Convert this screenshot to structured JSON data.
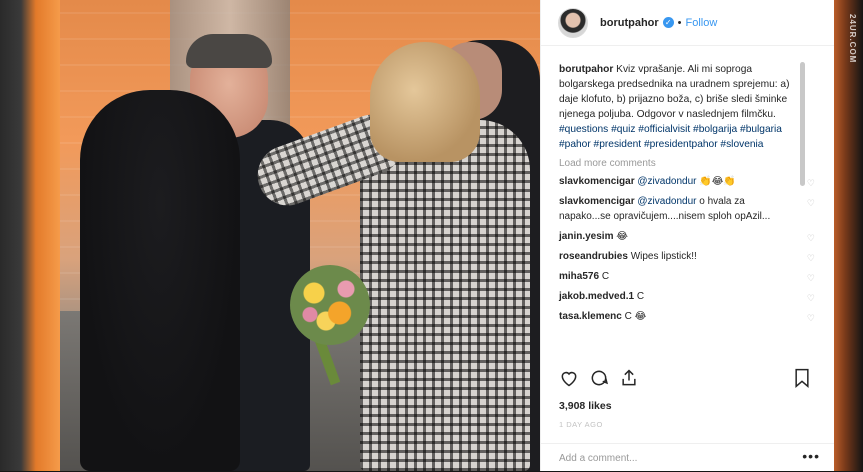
{
  "watermark": "24UR.COM",
  "post": {
    "username": "borutpahor",
    "verified_mark": "✓",
    "separator": "•",
    "follow_label": "Follow",
    "caption_user": "borutpahor",
    "caption_text": " Kviz vprašanje. Ali mi soproga bolgarskega predsednika na uradnem sprejemu: a) daje klofuto, b) prijazno boža, c) briše sledi šminke njenega poljuba. Odgovor v naslednjem filmčku. ",
    "hashtags": "#questions #quiz #officialvisit #bolgarija #bulgaria #pahor #president #presidentpahor #slovenia",
    "load_more": "Load more comments",
    "comments": [
      {
        "user": "slavkomencigar",
        "mention": "@zivadondur",
        "text": " 👏😂👏"
      },
      {
        "user": "slavkomencigar",
        "mention": "@zivadondur",
        "text": " o hvala za napako...se opravičujem....nisem sploh opAzil..."
      },
      {
        "user": "janin.yesim",
        "mention": "",
        "text": " 😂"
      },
      {
        "user": "roseandrubies",
        "mention": "",
        "text": " Wipes lipstick!!"
      },
      {
        "user": "miha576",
        "mention": "",
        "text": " C"
      },
      {
        "user": "jakob.medved.1",
        "mention": "",
        "text": " C"
      },
      {
        "user": "tasa.klemenc",
        "mention": "",
        "text": " C 😂"
      }
    ],
    "likes": "3,908 likes",
    "time": "1 DAY AGO",
    "add_comment_placeholder": "Add a comment...",
    "more_options": "•••",
    "small_heart": "♡"
  }
}
